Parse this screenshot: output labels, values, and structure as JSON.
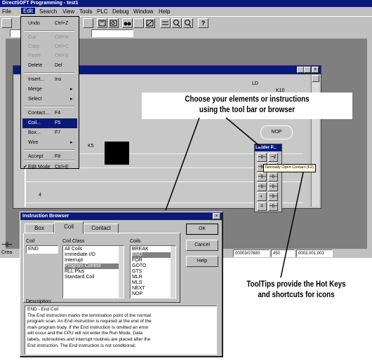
{
  "window": {
    "title": "DirectSOFT Programming - test1"
  },
  "menubar": [
    "File",
    "Edit",
    "Search",
    "View",
    "Tools",
    "PLC",
    "Debug",
    "Window",
    "Help"
  ],
  "edit_menu": [
    {
      "label": "Undo",
      "hotkey": "Ctrl+Z",
      "disabled": false
    },
    {
      "label": "Cut",
      "hotkey": "Ctrl+X",
      "disabled": true
    },
    {
      "label": "Copy",
      "hotkey": "Ctrl+C",
      "disabled": true
    },
    {
      "label": "Paste",
      "hotkey": "Ctrl+V",
      "disabled": true
    },
    {
      "label": "Delete",
      "hotkey": "Del",
      "disabled": false
    },
    {
      "label": "Insert...",
      "hotkey": "Ins",
      "disabled": false
    },
    {
      "label": "Merge",
      "hotkey": "",
      "disabled": false,
      "submenu": true
    },
    {
      "label": "Select",
      "hotkey": "",
      "disabled": false,
      "submenu": true
    },
    {
      "label": "Contact...",
      "hotkey": "F4",
      "disabled": false
    },
    {
      "label": "Coil...",
      "hotkey": "F5",
      "disabled": false,
      "selected": true
    },
    {
      "label": "Box...",
      "hotkey": "F7",
      "disabled": false
    },
    {
      "label": "Wire",
      "hotkey": "",
      "disabled": false,
      "submenu": true
    },
    {
      "label": "Accept",
      "hotkey": "F8",
      "disabled": false
    },
    {
      "label": "Edit Mode",
      "hotkey": "Ctrl+E",
      "disabled": false,
      "checked": true
    }
  ],
  "ladder": {
    "side_labels": [
      "LD",
      "K10"
    ],
    "nop_label": "NOP",
    "rung_labels": [
      "K5",
      "4"
    ]
  },
  "ladder_palette": {
    "title": "Ladder P...",
    "tooltip": "Normally Open Contact (F2)"
  },
  "instruction_browser": {
    "title": "Instruction Browser",
    "tabs": [
      "Box",
      "Coil",
      "Contact"
    ],
    "active_tab": "Coil",
    "coil_label": "Coil",
    "coil_value": "END",
    "coil_class_label": "Coil Class",
    "coil_classes": [
      "All Coils",
      "Immediate I/O",
      "Interrupt",
      "Program Control",
      "RLL Plus",
      "Standard Coil"
    ],
    "selected_class": "Program Control",
    "coils_label": "Coils",
    "coils": [
      "BREAK",
      "END",
      "FOR",
      "GOTO",
      "GTS",
      "MLR",
      "MLS",
      "NEXT",
      "NOP"
    ],
    "selected_coil": "END",
    "buttons": [
      "OK",
      "Cancel",
      "Help"
    ],
    "description_label": "Description:",
    "description_lines": [
      "END - End Coil",
      "The End instruction marks the termination point of the normal",
      "program scan. An End instruction is required at the end of the",
      "main program body. If the End instruction is omitted an error",
      "will occur and the CPU will not enter the Run Mode. Data",
      "labels, subroutines and interrupt routines are placed after the",
      "End instruction. The End instruction is not conditional;"
    ]
  },
  "statusbar": {
    "left": "Crea",
    "fields": [
      "00003/07680",
      "450",
      "0003.001.003"
    ]
  },
  "callouts": {
    "top": [
      "Choose your elements or instructions",
      "using the tool bar or browser"
    ],
    "bottom": [
      "ToolTips provide the Hot Keys",
      "and shortcuts for icons"
    ]
  }
}
